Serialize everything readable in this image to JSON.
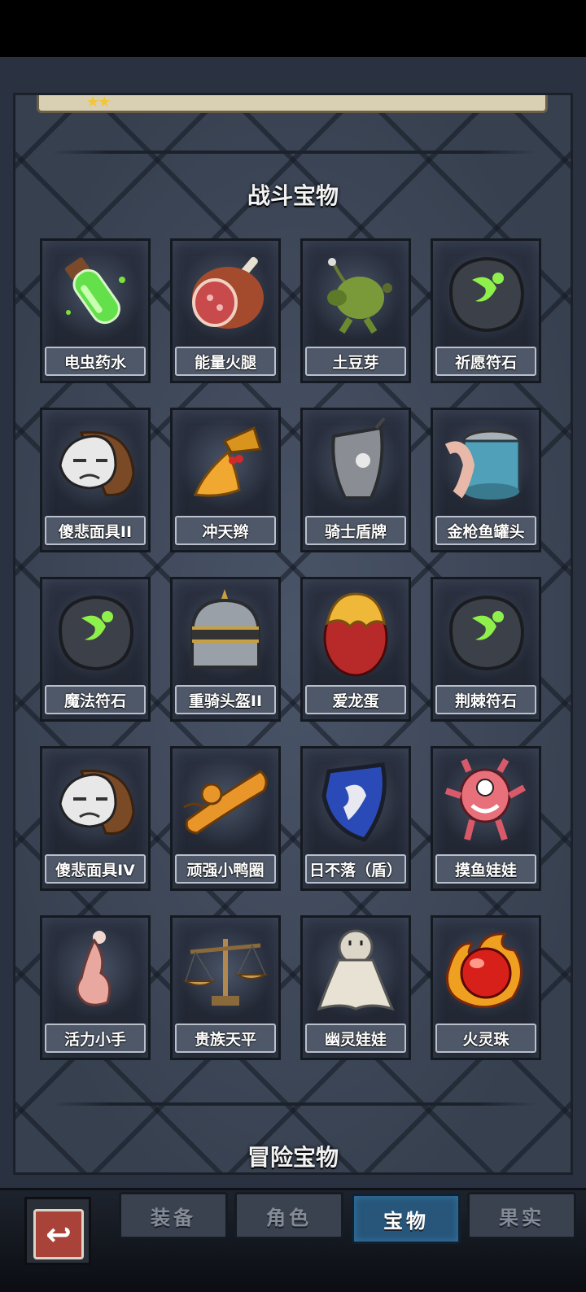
{
  "sections": {
    "battle_title": "战斗宝物",
    "adventure_title": "冒险宝物"
  },
  "items": [
    {
      "name": "电虫药水",
      "icon": "green-potion-icon"
    },
    {
      "name": "能量火腿",
      "icon": "ham-icon"
    },
    {
      "name": "土豆芽",
      "icon": "sprout-creature-icon"
    },
    {
      "name": "祈愿符石",
      "icon": "rune-stone-icon"
    },
    {
      "name": "傻悲面具II",
      "icon": "mask-icon"
    },
    {
      "name": "冲天辫",
      "icon": "pigtail-icon"
    },
    {
      "name": "骑士盾牌",
      "icon": "knight-shield-icon"
    },
    {
      "name": "金枪鱼罐头",
      "icon": "tuna-can-icon"
    },
    {
      "name": "魔法符石",
      "icon": "rune-stone-icon"
    },
    {
      "name": "重骑头盔II",
      "icon": "helmet-icon"
    },
    {
      "name": "爱龙蛋",
      "icon": "dragon-egg-icon"
    },
    {
      "name": "荆棘符石",
      "icon": "rune-stone-icon"
    },
    {
      "name": "傻悲面具IV",
      "icon": "mask-icon"
    },
    {
      "name": "顽强小鸭圈",
      "icon": "duck-ring-icon"
    },
    {
      "name": "日不落（盾）",
      "icon": "blue-shield-icon"
    },
    {
      "name": "摸鱼娃娃",
      "icon": "pink-doll-icon"
    },
    {
      "name": "活力小手",
      "icon": "hand-icon"
    },
    {
      "name": "贵族天平",
      "icon": "scales-icon"
    },
    {
      "name": "幽灵娃娃",
      "icon": "ghost-doll-icon"
    },
    {
      "name": "火灵珠",
      "icon": "fire-orb-icon"
    }
  ],
  "tabs": [
    {
      "label": "装备",
      "active": false
    },
    {
      "label": "角色",
      "active": false
    },
    {
      "label": "宝物",
      "active": true
    },
    {
      "label": "果实",
      "active": false
    }
  ],
  "back_button": {
    "icon": "back-arrow-icon",
    "glyph": "↩"
  },
  "stars_glyph": "★★",
  "colors": {
    "active_tab": "#27567a",
    "label_bg": "#4f5868",
    "rune_glow": "#7be03a"
  }
}
